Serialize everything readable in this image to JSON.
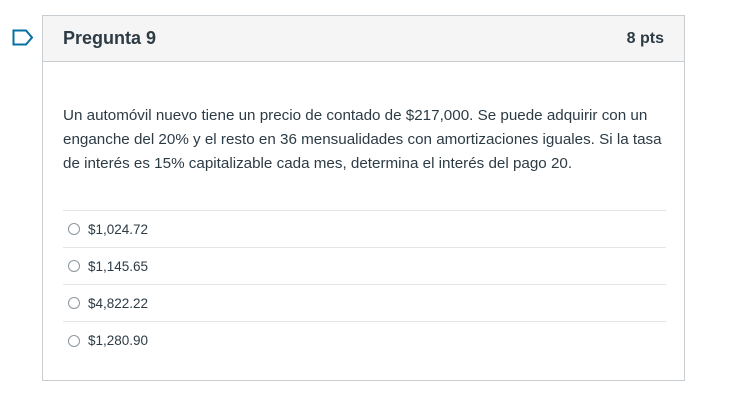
{
  "question": {
    "title": "Pregunta 9",
    "points": "8 pts",
    "text": "Un automóvil nuevo tiene un precio de contado de $217,000. Se puede adquirir con un enganche del 20% y el resto en 36 mensualidades con amortizaciones iguales. Si la tasa de interés es 15% capitalizable cada mes, determina el interés del pago 20.",
    "options": [
      {
        "label": "$1,024.72"
      },
      {
        "label": "$1,145.65"
      },
      {
        "label": "$4,822.22"
      },
      {
        "label": "$1,280.90"
      }
    ]
  },
  "icons": {
    "flag": "bookmark-flag-icon"
  },
  "colors": {
    "text": "#2d3b45",
    "flag": "#0770a3",
    "header_bg": "#f5f5f5",
    "border": "#c7cdd1"
  }
}
